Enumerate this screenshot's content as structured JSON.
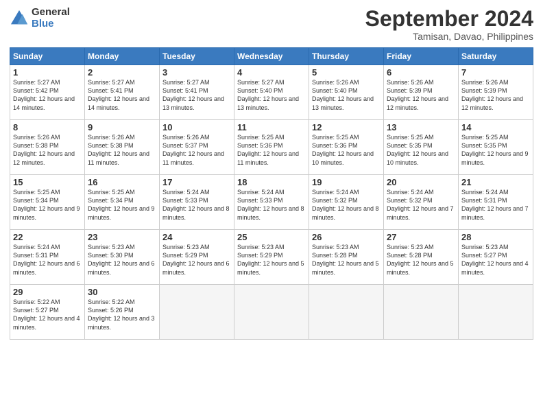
{
  "logo": {
    "general": "General",
    "blue": "Blue"
  },
  "title": "September 2024",
  "location": "Tamisan, Davao, Philippines",
  "days_of_week": [
    "Sunday",
    "Monday",
    "Tuesday",
    "Wednesday",
    "Thursday",
    "Friday",
    "Saturday"
  ],
  "weeks": [
    [
      {
        "day": 1,
        "sunrise": "5:27 AM",
        "sunset": "5:42 PM",
        "daylight": "12 hours and 14 minutes."
      },
      {
        "day": 2,
        "sunrise": "5:27 AM",
        "sunset": "5:41 PM",
        "daylight": "12 hours and 14 minutes."
      },
      {
        "day": 3,
        "sunrise": "5:27 AM",
        "sunset": "5:41 PM",
        "daylight": "12 hours and 13 minutes."
      },
      {
        "day": 4,
        "sunrise": "5:27 AM",
        "sunset": "5:40 PM",
        "daylight": "12 hours and 13 minutes."
      },
      {
        "day": 5,
        "sunrise": "5:26 AM",
        "sunset": "5:40 PM",
        "daylight": "12 hours and 13 minutes."
      },
      {
        "day": 6,
        "sunrise": "5:26 AM",
        "sunset": "5:39 PM",
        "daylight": "12 hours and 12 minutes."
      },
      {
        "day": 7,
        "sunrise": "5:26 AM",
        "sunset": "5:39 PM",
        "daylight": "12 hours and 12 minutes."
      }
    ],
    [
      {
        "day": 8,
        "sunrise": "5:26 AM",
        "sunset": "5:38 PM",
        "daylight": "12 hours and 12 minutes."
      },
      {
        "day": 9,
        "sunrise": "5:26 AM",
        "sunset": "5:38 PM",
        "daylight": "12 hours and 11 minutes."
      },
      {
        "day": 10,
        "sunrise": "5:26 AM",
        "sunset": "5:37 PM",
        "daylight": "12 hours and 11 minutes."
      },
      {
        "day": 11,
        "sunrise": "5:25 AM",
        "sunset": "5:36 PM",
        "daylight": "12 hours and 11 minutes."
      },
      {
        "day": 12,
        "sunrise": "5:25 AM",
        "sunset": "5:36 PM",
        "daylight": "12 hours and 10 minutes."
      },
      {
        "day": 13,
        "sunrise": "5:25 AM",
        "sunset": "5:35 PM",
        "daylight": "12 hours and 10 minutes."
      },
      {
        "day": 14,
        "sunrise": "5:25 AM",
        "sunset": "5:35 PM",
        "daylight": "12 hours and 9 minutes."
      }
    ],
    [
      {
        "day": 15,
        "sunrise": "5:25 AM",
        "sunset": "5:34 PM",
        "daylight": "12 hours and 9 minutes."
      },
      {
        "day": 16,
        "sunrise": "5:25 AM",
        "sunset": "5:34 PM",
        "daylight": "12 hours and 9 minutes."
      },
      {
        "day": 17,
        "sunrise": "5:24 AM",
        "sunset": "5:33 PM",
        "daylight": "12 hours and 8 minutes."
      },
      {
        "day": 18,
        "sunrise": "5:24 AM",
        "sunset": "5:33 PM",
        "daylight": "12 hours and 8 minutes."
      },
      {
        "day": 19,
        "sunrise": "5:24 AM",
        "sunset": "5:32 PM",
        "daylight": "12 hours and 8 minutes."
      },
      {
        "day": 20,
        "sunrise": "5:24 AM",
        "sunset": "5:32 PM",
        "daylight": "12 hours and 7 minutes."
      },
      {
        "day": 21,
        "sunrise": "5:24 AM",
        "sunset": "5:31 PM",
        "daylight": "12 hours and 7 minutes."
      }
    ],
    [
      {
        "day": 22,
        "sunrise": "5:24 AM",
        "sunset": "5:31 PM",
        "daylight": "12 hours and 6 minutes."
      },
      {
        "day": 23,
        "sunrise": "5:23 AM",
        "sunset": "5:30 PM",
        "daylight": "12 hours and 6 minutes."
      },
      {
        "day": 24,
        "sunrise": "5:23 AM",
        "sunset": "5:29 PM",
        "daylight": "12 hours and 6 minutes."
      },
      {
        "day": 25,
        "sunrise": "5:23 AM",
        "sunset": "5:29 PM",
        "daylight": "12 hours and 5 minutes."
      },
      {
        "day": 26,
        "sunrise": "5:23 AM",
        "sunset": "5:28 PM",
        "daylight": "12 hours and 5 minutes."
      },
      {
        "day": 27,
        "sunrise": "5:23 AM",
        "sunset": "5:28 PM",
        "daylight": "12 hours and 5 minutes."
      },
      {
        "day": 28,
        "sunrise": "5:23 AM",
        "sunset": "5:27 PM",
        "daylight": "12 hours and 4 minutes."
      }
    ],
    [
      {
        "day": 29,
        "sunrise": "5:22 AM",
        "sunset": "5:27 PM",
        "daylight": "12 hours and 4 minutes."
      },
      {
        "day": 30,
        "sunrise": "5:22 AM",
        "sunset": "5:26 PM",
        "daylight": "12 hours and 3 minutes."
      },
      null,
      null,
      null,
      null,
      null
    ]
  ]
}
